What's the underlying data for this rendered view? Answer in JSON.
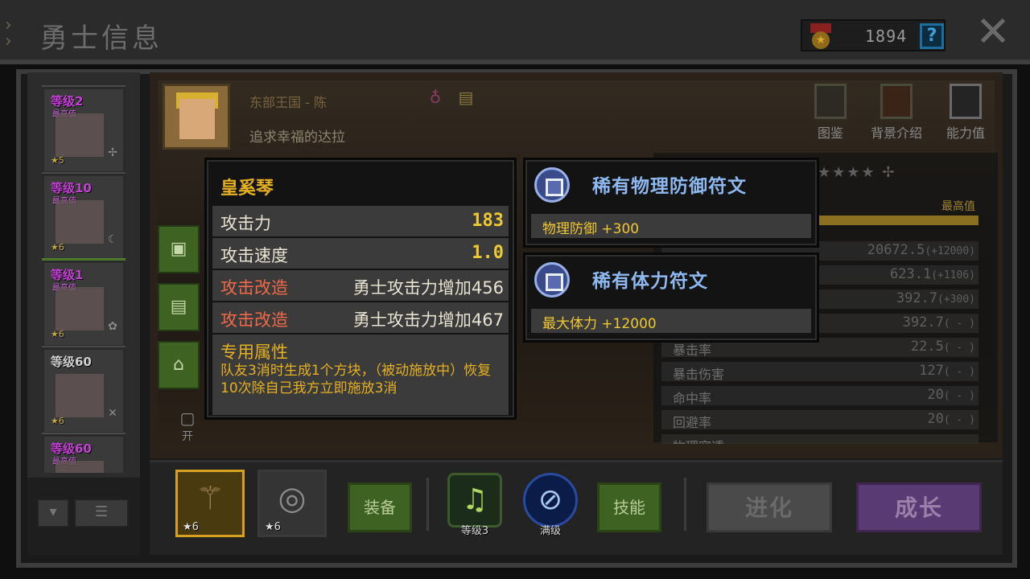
{
  "header": {
    "title": "勇士信息",
    "currency_value": "1894",
    "help_label": "?",
    "close_label": "✕"
  },
  "hero_list": [
    {
      "level": "等级2",
      "sub": "最高值",
      "stars": "★5",
      "style": "purple"
    },
    {
      "level": "等级10",
      "sub": "最高值",
      "stars": "★6",
      "style": "purple"
    },
    {
      "level": "等级1",
      "sub": "最高值",
      "stars": "★6",
      "style": "purple"
    },
    {
      "level": "等级60",
      "sub": "",
      "stars": "★6",
      "style": "plain"
    },
    {
      "level": "等级60",
      "sub": "最高值",
      "stars": "",
      "style": "purple"
    }
  ],
  "hero": {
    "kingdom": "东部王国 - 陈",
    "motto": "追求幸福的达拉"
  },
  "tabs": [
    {
      "label": "图鉴"
    },
    {
      "label": "背景介绍"
    },
    {
      "label": "能力值"
    }
  ],
  "stats": {
    "max_label": "最高值",
    "rows": [
      {
        "name": "",
        "value": "20672.5",
        "extra": "(+12000)"
      },
      {
        "name": "",
        "value": "623.1",
        "extra": "(+1106)"
      },
      {
        "name": "",
        "value": "392.7",
        "extra": "(+300)"
      },
      {
        "name": "",
        "value": "392.7",
        "extra": "( - )"
      },
      {
        "name": "暴击率",
        "value": "22.5",
        "extra": "( - )"
      },
      {
        "name": "暴击伤害",
        "value": "127",
        "extra": "( - )"
      },
      {
        "name": "命中率",
        "value": "20",
        "extra": "( - )"
      },
      {
        "name": "回避率",
        "value": "20",
        "extra": "( - )"
      },
      {
        "name": "物理穿透",
        "value": "",
        "extra": ""
      }
    ]
  },
  "weapon_tooltip": {
    "name": "皇奚琴",
    "rows": [
      {
        "key": "攻击力",
        "value": "183",
        "style": "num"
      },
      {
        "key": "攻击速度",
        "value": "1.0",
        "style": "num"
      },
      {
        "key": "攻击改造",
        "value": "勇士攻击力增加456",
        "style": "text"
      },
      {
        "key": "攻击改造",
        "value": "勇士攻击力增加467",
        "style": "text"
      }
    ],
    "special_title": "专用属性",
    "special_desc": "队友3消时生成1个方块，（被动施放中）恢复10次除自己我方立即施放3消"
  },
  "rune_tooltips": [
    {
      "name": "稀有物理防御符文",
      "value": "物理防御 +300"
    },
    {
      "name": "稀有体力符文",
      "value": "最大体力 +12000"
    }
  ],
  "bottom": {
    "slot_weapon_stars": "★6",
    "slot_ring_stars": "★6",
    "equip_label": "装备",
    "skill1_caption": "等级3",
    "skill2_caption": "满级",
    "skill_label": "技能",
    "evolve_label": "进化",
    "grow_label": "成长"
  },
  "lock_label": "开",
  "colors": {
    "accent_gold": "#e6b020",
    "modify_red": "#ef6848",
    "rune_blue": "#8eb8f0",
    "button_green": "#3e6222",
    "grow_purple": "#5a3a72"
  }
}
